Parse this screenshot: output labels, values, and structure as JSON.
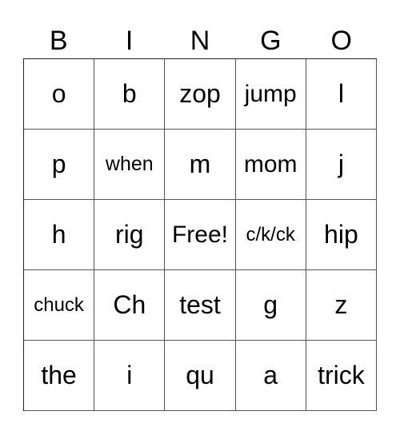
{
  "card": {
    "header": [
      "B",
      "I",
      "N",
      "G",
      "O"
    ],
    "rows": [
      [
        "o",
        "b",
        "zop",
        "jump",
        "l"
      ],
      [
        "p",
        "when",
        "m",
        "mom",
        "j"
      ],
      [
        "h",
        "rig",
        "Free!",
        "c/k/ck",
        "hip"
      ],
      [
        "chuck",
        "Ch",
        "test",
        "g",
        "z"
      ],
      [
        "the",
        "i",
        "qu",
        "a",
        "trick"
      ]
    ],
    "free_space": "Free!"
  }
}
